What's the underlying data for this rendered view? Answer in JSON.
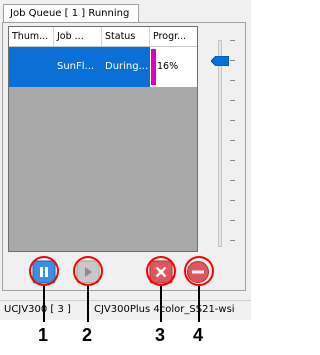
{
  "tab": {
    "label": "Job Queue [ 1 ] Running"
  },
  "table": {
    "columns": [
      "Thum...",
      "Job ...",
      "Status",
      "Progr..."
    ],
    "rows": [
      {
        "thumbnail": "",
        "job": "SunFl...",
        "status": "During...",
        "progress": "16%",
        "progress_value": 0.16
      }
    ]
  },
  "buttons": {
    "pause": "pause-icon",
    "play": "play-icon",
    "delete": "delete-x-icon",
    "cancel": "cancel-minus-icon"
  },
  "status_bar": {
    "printer": "UCJV300 [ 3 ]",
    "profile": "CJV300Plus 4color_SS21-wsi"
  },
  "callouts": [
    "1",
    "2",
    "3",
    "4"
  ],
  "colors": {
    "selection": "#0a6fd6",
    "progress": "#e000c0",
    "callout_circle": "#ff0000"
  }
}
